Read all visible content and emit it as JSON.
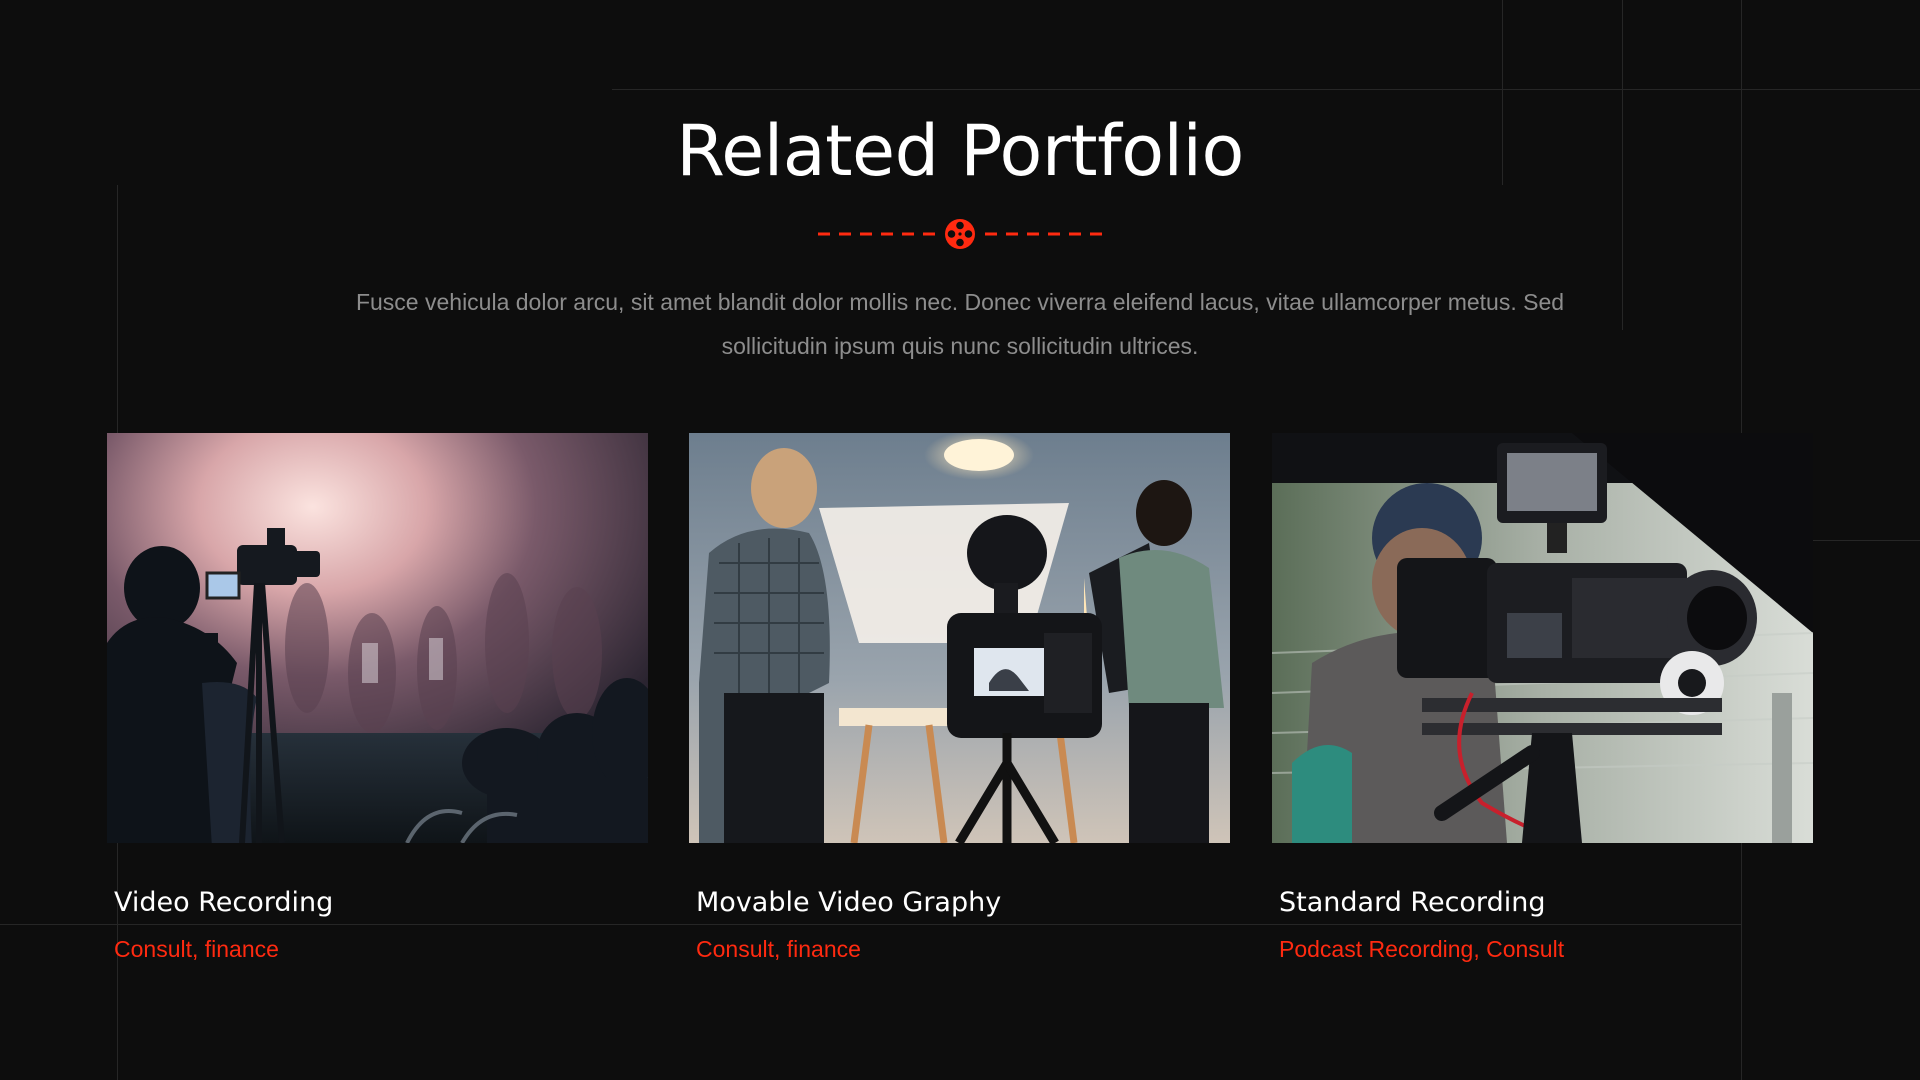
{
  "section": {
    "title": "Related Portfolio",
    "description": "Fusce vehicula dolor arcu, sit amet blandit dolor mollis nec. Donec viverra eleifend lacus, vitae ullamcorper metus. Sed sollicitudin ipsum quis nunc sollicitudin ultrices."
  },
  "colors": {
    "background": "#0d0d0d",
    "accent": "#ff2a10",
    "text": "#ffffff",
    "muted": "#8d8d8d"
  },
  "divider_icon": "film-reel-icon",
  "portfolio": [
    {
      "title": "Video Recording",
      "tags": "Consult, finance",
      "image": "event-videographer-photo"
    },
    {
      "title": "Movable Video Graphy",
      "tags": "Consult, finance",
      "image": "photo-studio-camera-photo"
    },
    {
      "title": "Standard Recording",
      "tags": "Podcast Recording, Consult",
      "image": "cinema-camera-rig-photo"
    }
  ]
}
